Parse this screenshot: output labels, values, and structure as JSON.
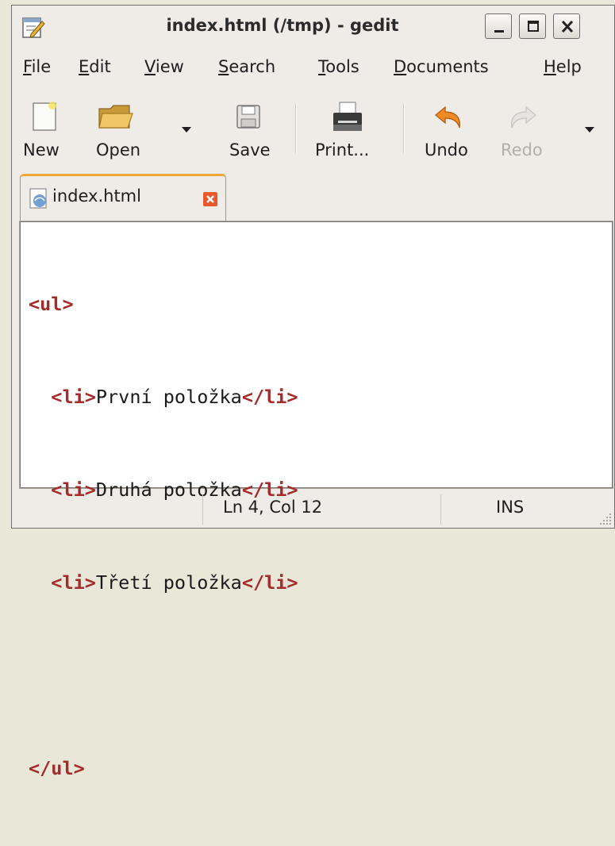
{
  "window": {
    "title": "index.html (/tmp) - gedit"
  },
  "menu": {
    "file": {
      "key": "F",
      "rest": "ile"
    },
    "edit": {
      "key": "E",
      "rest": "dit"
    },
    "view": {
      "key": "V",
      "rest": "iew"
    },
    "search": {
      "key": "S",
      "rest": "earch"
    },
    "tools": {
      "key": "T",
      "rest": "ools"
    },
    "documents": {
      "key": "D",
      "rest": "ocuments"
    },
    "help": {
      "key": "H",
      "rest": "elp"
    }
  },
  "toolbar": {
    "new": "New",
    "open": "Open",
    "save": "Save",
    "print": "Print...",
    "undo": "Undo",
    "redo": "Redo"
  },
  "tab": {
    "label": "index.html"
  },
  "editor": {
    "lines": [
      {
        "indent": "",
        "open": "<ul>",
        "text": "",
        "close": ""
      },
      {
        "indent": "  ",
        "open": "<li>",
        "text": "První položka",
        "close": "</li>"
      },
      {
        "indent": "  ",
        "open": "<li>",
        "text": "Druhá položka",
        "close": "</li>"
      },
      {
        "indent": "  ",
        "open": "<li>",
        "text": "Třetí položka",
        "close": "</li>"
      },
      {
        "indent": "",
        "open": "",
        "text": "",
        "close": ""
      },
      {
        "indent": "",
        "open": "</ul>",
        "text": "",
        "close": ""
      }
    ]
  },
  "status": {
    "position": "Ln 4, Col 12",
    "mode": "INS"
  },
  "colors": {
    "tag": "#a52a2a",
    "tab_accent": "#f2a83b",
    "close_icon": "#e8582a"
  }
}
